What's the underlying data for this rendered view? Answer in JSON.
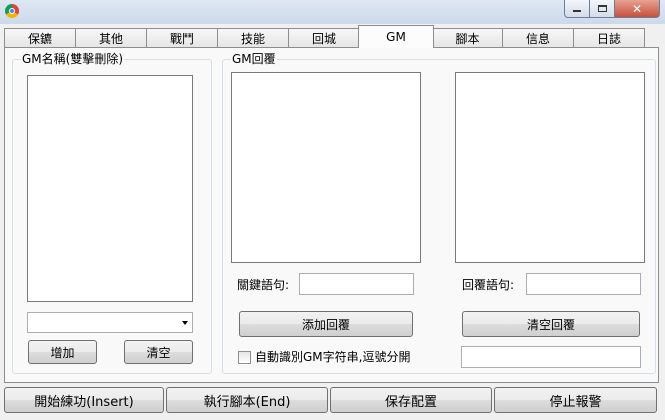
{
  "tabs": [
    "保鑣",
    "其他",
    "戰鬥",
    "技能",
    "回城",
    "GM",
    "腳本",
    "信息",
    "日誌"
  ],
  "active_tab": "GM",
  "gm_names": {
    "title": "GM名稱(雙擊刪除)",
    "combo_value": "",
    "add_label": "增加",
    "clear_label": "清空"
  },
  "gm_reply": {
    "title": "GM回覆",
    "keyword_label": "關鍵語句:",
    "keyword_value": "",
    "reply_label": "回覆語句:",
    "reply_value": "",
    "add_reply_label": "添加回覆",
    "clear_reply_label": "清空回覆",
    "auto_detect_label": "自動識別GM字符串,逗號分開",
    "auto_detect_checked": false,
    "auto_detect_value": ""
  },
  "bottom": {
    "start_label": "開始練功(Insert)",
    "script_label": "執行腳本(End)",
    "save_label": "保存配置",
    "stop_label": "停止報警"
  }
}
